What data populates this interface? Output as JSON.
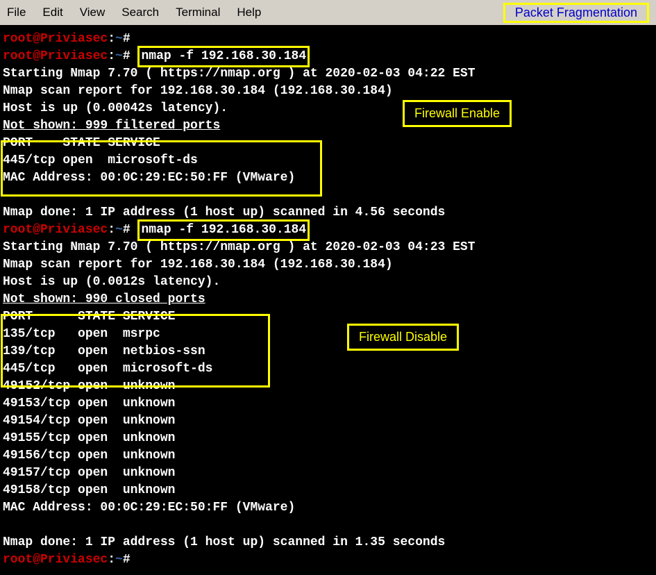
{
  "menubar": {
    "file": "File",
    "edit": "Edit",
    "view": "View",
    "search": "Search",
    "terminal": "Terminal",
    "help": "Help",
    "title": "Packet Fragmentation"
  },
  "prompt": {
    "userhost": "root@Priviasec",
    "colon": ":",
    "path": "~",
    "hash": "#"
  },
  "cmd1": "nmap -f 192.168.30.184",
  "cmd2": "nmap -f 192.168.30.184",
  "scan1": {
    "starting": "Starting Nmap 7.70 ( https://nmap.org ) at 2020-02-03 04:22 EST",
    "report": "Nmap scan report for 192.168.30.184 (192.168.30.184)",
    "host": "Host is up (0.00042s latency).",
    "notshown": "Not shown: 999 filtered ports",
    "header": "PORT    STATE SERVICE",
    "port": "445/tcp open  microsoft-ds",
    "mac": "MAC Address: 00:0C:29:EC:50:FF (VMware)",
    "done": "Nmap done: 1 IP address (1 host up) scanned in 4.56 seconds"
  },
  "scan2": {
    "starting": "Starting Nmap 7.70 ( https://nmap.org ) at 2020-02-03 04:23 EST",
    "report": "Nmap scan report for 192.168.30.184 (192.168.30.184)",
    "host": "Host is up (0.0012s latency).",
    "notshown": "Not shown: 990 closed ports",
    "header": "PORT      STATE SERVICE",
    "p1": "135/tcp   open  msrpc",
    "p2": "139/tcp   open  netbios-ssn",
    "p3": "445/tcp   open  microsoft-ds",
    "p4": "49152/tcp open  unknown",
    "p5": "49153/tcp open  unknown",
    "p6": "49154/tcp open  unknown",
    "p7": "49155/tcp open  unknown",
    "p8": "49156/tcp open  unknown",
    "p9": "49157/tcp open  unknown",
    "p10": "49158/tcp open  unknown",
    "mac": "MAC Address: 00:0C:29:EC:50:FF (VMware)",
    "done": "Nmap done: 1 IP address (1 host up) scanned in 1.35 seconds"
  },
  "labels": {
    "enable": "Firewall Enable",
    "disable": "Firewall Disable"
  }
}
